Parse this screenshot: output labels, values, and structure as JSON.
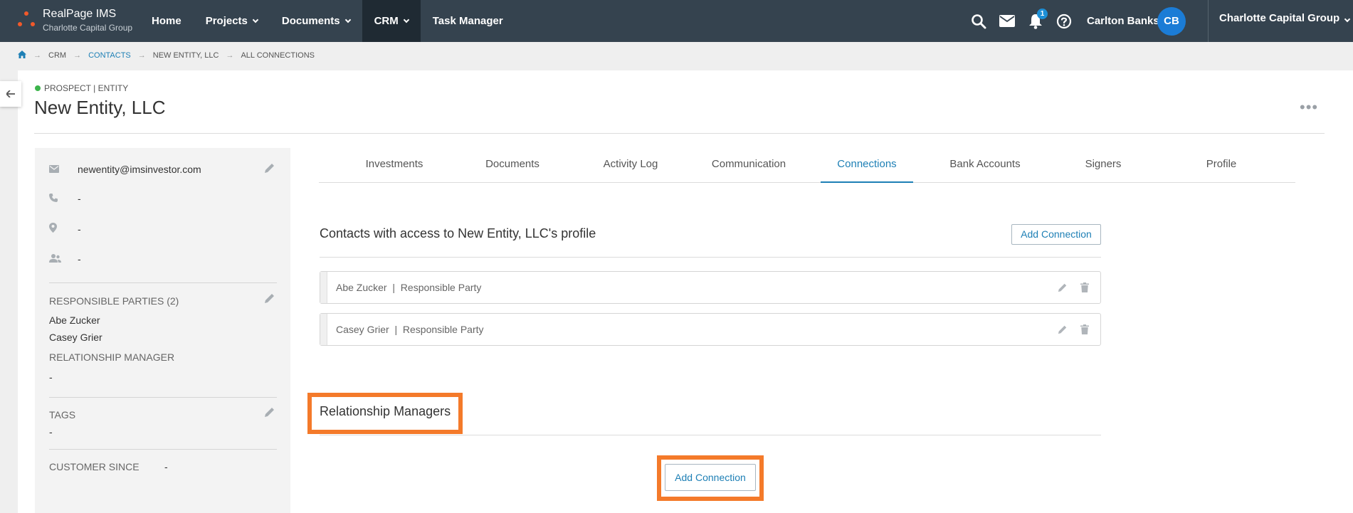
{
  "app": {
    "name": "RealPage IMS",
    "org_sub": "Charlotte Capital Group"
  },
  "nav": [
    {
      "label": "Home",
      "has_menu": false,
      "active": false
    },
    {
      "label": "Projects",
      "has_menu": true,
      "active": false
    },
    {
      "label": "Documents",
      "has_menu": true,
      "active": false
    },
    {
      "label": "CRM",
      "has_menu": true,
      "active": true
    },
    {
      "label": "Task Manager",
      "has_menu": false,
      "active": false
    }
  ],
  "header_icons": [
    "search-icon",
    "mail-icon",
    "bell-icon",
    "help-icon"
  ],
  "notifications_count": "1",
  "user": {
    "name": "Carlton Banks",
    "initials": "CB"
  },
  "org_selector": "Charlotte Capital Group",
  "breadcrumb": [
    "CRM",
    "CONTACTS",
    "NEW ENTITY, LLC",
    "ALL CONNECTIONS"
  ],
  "entity": {
    "status": "PROSPECT | ENTITY",
    "name": "New Entity, LLC"
  },
  "sidebar": {
    "email": "newentity@imsinvestor.com",
    "phone": "-",
    "address": "-",
    "contact": "-",
    "responsible_parties_header": "RESPONSIBLE PARTIES (2)",
    "responsible_parties": [
      "Abe Zucker",
      "Casey Grier"
    ],
    "relationship_manager_header": "RELATIONSHIP MANAGER",
    "relationship_manager": "-",
    "tags_header": "TAGS",
    "tags": "-",
    "customer_since_header": "CUSTOMER SINCE",
    "customer_since": "-"
  },
  "tabs": [
    "Investments",
    "Documents",
    "Activity Log",
    "Communication",
    "Connections",
    "Bank Accounts",
    "Signers",
    "Profile"
  ],
  "active_tab": "Connections",
  "connections": {
    "section_title": "Contacts with access to New Entity, LLC's profile",
    "add_label": "Add Connection",
    "rows": [
      {
        "name": "Abe Zucker",
        "role": "Responsible Party"
      },
      {
        "name": "Casey Grier",
        "role": "Responsible Party"
      }
    ]
  },
  "managers": {
    "section_title": "Relationship Managers",
    "add_label": "Add Connection"
  },
  "colors": {
    "topbar": "#35434f",
    "accent": "#1d7fb5",
    "highlight": "#f47a2a",
    "avatar": "#1b7cd6"
  }
}
